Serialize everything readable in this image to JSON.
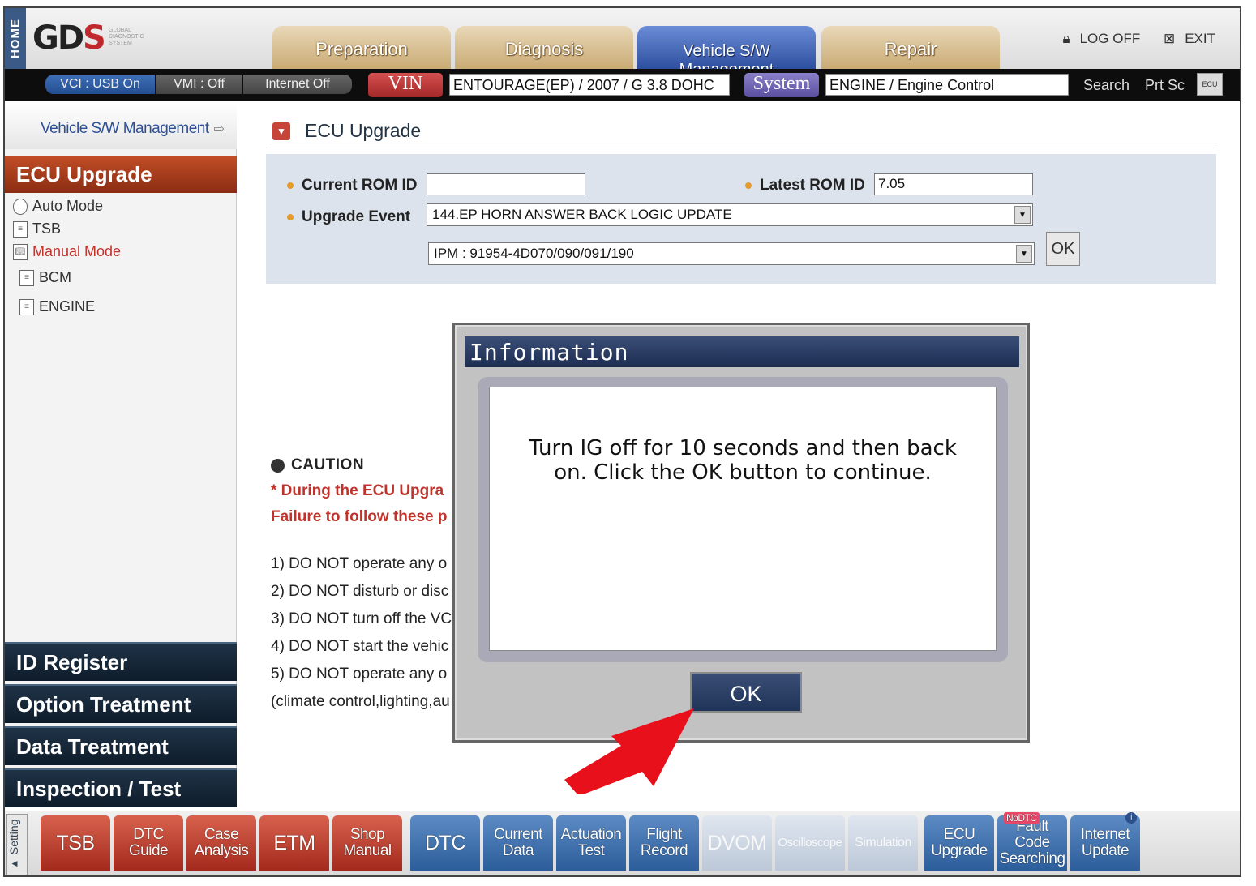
{
  "header": {
    "home_label": "HOME",
    "logo_text": "GD",
    "logo_accent": "S",
    "logo_sub": "GLOBAL DIAGNOSTIC SYSTEM",
    "tabs": [
      {
        "label": "Preparation",
        "active": false
      },
      {
        "label": "Diagnosis",
        "active": false
      },
      {
        "label": "Vehicle S/W Management",
        "active": true
      },
      {
        "label": "Repair",
        "active": false
      }
    ],
    "log_off": "LOG OFF",
    "exit": "EXIT"
  },
  "statusbar": {
    "vci": "VCI : USB On",
    "vmi": "VMI : Off",
    "internet": "Internet Off",
    "vin_label": "VIN",
    "vin_value": "ENTOURAGE(EP) / 2007 / G 3.8 DOHC",
    "system_label": "System",
    "system_value": "ENGINE / Engine Control",
    "search": "Search",
    "prtsc": "Prt Sc",
    "ecu_icon_text": "ECU"
  },
  "sidebar": {
    "header": "Vehicle S/W Management",
    "section_title": "ECU Upgrade",
    "items": [
      {
        "label": "Auto Mode",
        "icon": "disc-icon"
      },
      {
        "label": "TSB",
        "icon": "document-icon"
      },
      {
        "label": "Manual Mode",
        "icon": "book-icon"
      },
      {
        "label": "BCM",
        "icon": "document-icon"
      },
      {
        "label": "ENGINE",
        "icon": "document-icon"
      }
    ],
    "bottom_sections": [
      "ID Register",
      "Option Treatment",
      "Data Treatment",
      "Inspection / Test"
    ]
  },
  "main": {
    "title": "ECU Upgrade",
    "current_rom_label": "Current ROM ID",
    "current_rom_value": "",
    "latest_rom_label": "Latest ROM ID",
    "latest_rom_value": "7.05",
    "upgrade_event_label": "Upgrade Event",
    "upgrade_event_value": "144.EP HORN ANSWER BACK LOGIC UPDATE",
    "part_value": "IPM : 91954-4D070/090/091/190",
    "ok_label": "OK",
    "caution": {
      "heading": "CAUTION",
      "line1": "* During the ECU Upgra",
      "line2": "Failure to follow these p",
      "rules": [
        "1) DO NOT operate any o",
        "2) DO NOT disturb or disc",
        "3) DO NOT turn off the VC",
        "4) DO NOT start the vehic",
        "5) DO NOT operate any o",
        "(climate control,lighting,au"
      ]
    }
  },
  "dialog": {
    "title": "Information",
    "message": "Turn IG off for 10 seconds and then back on. Click the OK button to continue.",
    "ok_label": "OK"
  },
  "bottombar": {
    "setting": "Setting",
    "buttons": [
      {
        "label": "TSB",
        "style": "red"
      },
      {
        "label": "DTC Guide",
        "style": "red"
      },
      {
        "label": "Case Analysis",
        "style": "red"
      },
      {
        "label": "ETM",
        "style": "red"
      },
      {
        "label": "Shop Manual",
        "style": "red"
      },
      {
        "label": "DTC",
        "style": "blue"
      },
      {
        "label": "Current Data",
        "style": "blue"
      },
      {
        "label": "Actuation Test",
        "style": "blue"
      },
      {
        "label": "Flight Record",
        "style": "blue"
      },
      {
        "label": "DVOM",
        "style": "gray"
      },
      {
        "label": "Oscilloscope",
        "style": "gray"
      },
      {
        "label": "Simulation",
        "style": "gray"
      },
      {
        "label": "ECU Upgrade",
        "style": "blue"
      },
      {
        "label": "Fault Code Searching",
        "style": "blue",
        "badge": "NoDTC"
      },
      {
        "label": "Internet Update",
        "style": "blue",
        "badge": "i"
      }
    ]
  }
}
